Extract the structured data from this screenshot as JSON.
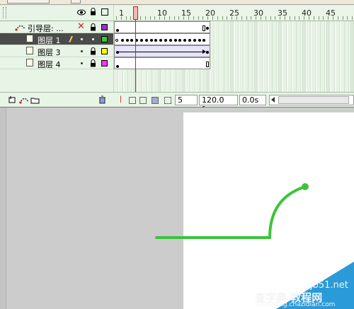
{
  "timeline": {
    "ruler_numbers": [
      "1",
      "5",
      "10",
      "15",
      "20",
      "25",
      "30",
      "35",
      "40",
      "45"
    ],
    "layers": [
      {
        "name": "引导层: ...",
        "type": "guide",
        "color": "#9933cc",
        "selected": false
      },
      {
        "name": "图层 1",
        "type": "normal",
        "color": "#33cc33",
        "selected": true
      },
      {
        "name": "图层 3",
        "type": "normal",
        "color": "#ffff00",
        "selected": false
      },
      {
        "name": "图层 4",
        "type": "normal",
        "color": "#ff33ff",
        "selected": false
      }
    ],
    "header_icons": [
      "eye-icon",
      "lock-icon",
      "outline-icon"
    ]
  },
  "toolbar": {
    "current_frame": "5",
    "fps": "120.0 fps",
    "elapsed": "0.0s",
    "left_icons": [
      "add-layer-icon",
      "add-guide-layer-icon",
      "add-folder-icon"
    ],
    "trash_icon": "delete-layer-icon"
  },
  "stage": {
    "path_color": "#3cc43c"
  },
  "watermark": {
    "line1": "jb51.net",
    "line2": "查字典 教程网",
    "line3": "jiaocheng.chazidian.com"
  }
}
